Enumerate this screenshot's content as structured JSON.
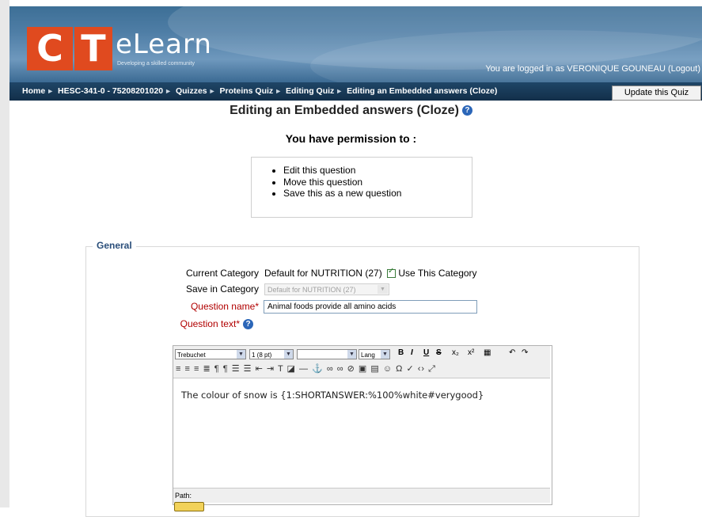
{
  "header": {
    "logo_letters": "CT",
    "brand": "eLearn",
    "tagline": "Developing a skilled community",
    "login_text": "You are logged in as VERONIQUE GOUNEAU (Logout)"
  },
  "breadcrumb": {
    "items": [
      "Home",
      "HESC-341-0 - 75208201020",
      "Quizzes",
      "Proteins Quiz",
      "Editing Quiz",
      "Editing an Embedded answers (Cloze)"
    ]
  },
  "update_button": "Update this Quiz",
  "page_title": "Editing an Embedded answers (Cloze)",
  "permissions": {
    "heading": "You have permission to :",
    "items": [
      "Edit this question",
      "Move this question",
      "Save this as a new question"
    ]
  },
  "form": {
    "legend": "General",
    "current_category_label": "Current Category",
    "current_category_value": "Default for NUTRITION (27)",
    "use_category_label": "Use This Category",
    "save_category_label": "Save in Category",
    "save_category_value": "Default for NUTRITION (27)",
    "question_name_label": "Question name",
    "question_name_value": "Animal foods provide all amino acids",
    "question_text_label": "Question text",
    "required_mark": "*"
  },
  "editor": {
    "font_value": "Trebuchet",
    "size_value": "1 (8 pt)",
    "lang_value": "Lang",
    "content": "The colour of snow is {1:SHORTANSWER:%100%white#verygood}",
    "path_label": "Path:"
  },
  "colors": {
    "header_blue": "#4f7ea6",
    "nav_dark": "#1f4667",
    "logo_orange": "#e04a1f",
    "legend_blue": "#2a4e7a",
    "required_red": "#b10000"
  }
}
